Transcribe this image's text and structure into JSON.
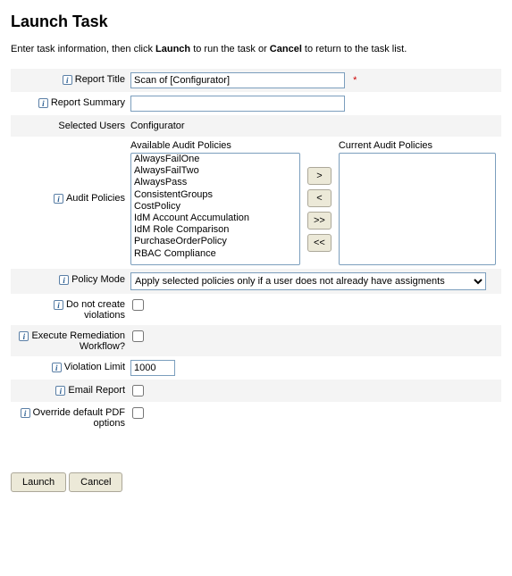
{
  "page_title": "Launch Task",
  "intro_prefix": "Enter task information, then click ",
  "intro_bold1": "Launch",
  "intro_mid": " to run the task or ",
  "intro_bold2": "Cancel",
  "intro_suffix": " to return to the task list.",
  "labels": {
    "report_title": "Report Title",
    "report_summary": "Report Summary",
    "selected_users": "Selected Users",
    "audit_policies": "Audit Policies",
    "available": "Available Audit Policies",
    "current": "Current Audit Policies",
    "policy_mode": "Policy Mode",
    "do_not_create": "Do not create violations",
    "execute_remediation": "Execute Remediation Workflow?",
    "violation_limit": "Violation Limit",
    "email_report": "Email Report",
    "override_pdf": "Override default PDF options"
  },
  "values": {
    "report_title": "Scan of [Configurator]",
    "report_summary": "",
    "selected_users": "Configurator",
    "violation_limit": "1000"
  },
  "available_policies": [
    "AlwaysFailOne",
    "AlwaysFailTwo",
    "AlwaysPass",
    "ConsistentGroups",
    "CostPolicy",
    "IdM Account Accumulation",
    "IdM Role Comparison",
    "PurchaseOrderPolicy",
    "RBAC Compliance"
  ],
  "current_policies": [],
  "shuttle": {
    "add": ">",
    "remove": "<",
    "add_all": ">>",
    "remove_all": "<<"
  },
  "policy_mode_selected": "Apply selected policies only if a user does not already have assigments",
  "actions": {
    "launch": "Launch",
    "cancel": "Cancel"
  }
}
